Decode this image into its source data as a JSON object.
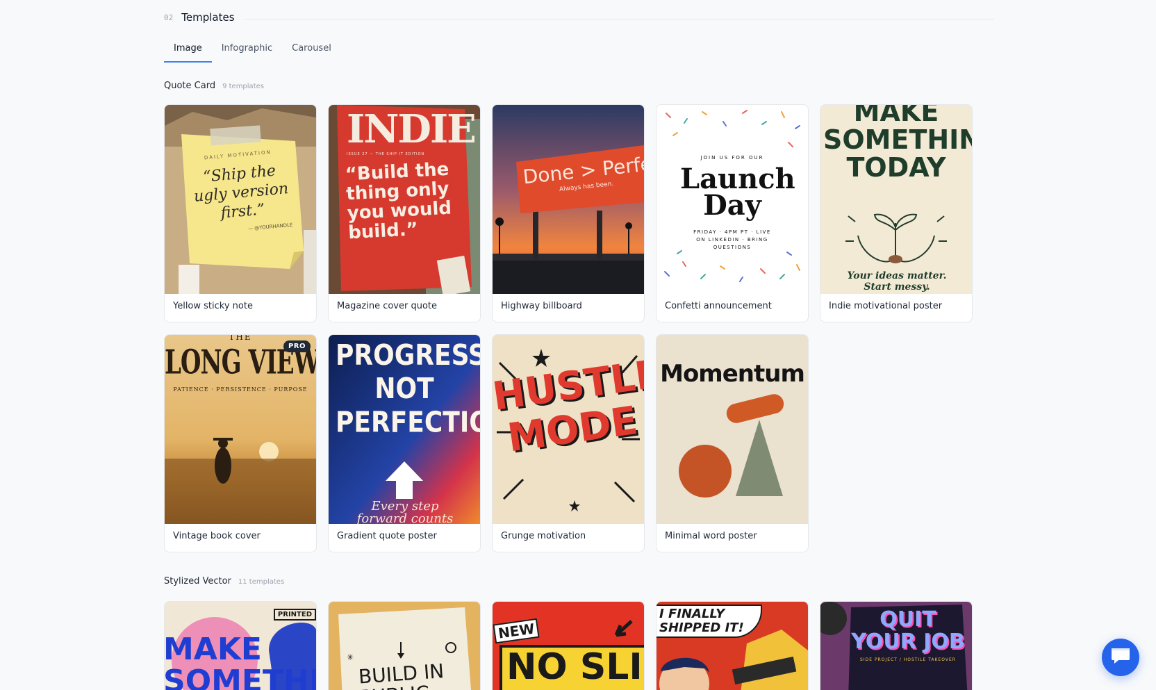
{
  "section": {
    "number": "02",
    "title": "Templates"
  },
  "tabs": [
    {
      "label": "Image",
      "active": true
    },
    {
      "label": "Infographic",
      "active": false
    },
    {
      "label": "Carousel",
      "active": false
    }
  ],
  "groups": [
    {
      "title": "Quote Card",
      "count": "9 templates",
      "templates": [
        {
          "label": "Yellow sticky note",
          "art": {
            "eyebrow": "DAILY MOTIVATION",
            "quote": "“Ship the ugly version first.”",
            "byline": "— @YOURHANDLE"
          }
        },
        {
          "label": "Magazine cover quote",
          "art": {
            "masthead": "INDIE",
            "issue": "ISSUE 27 — THE SHIP IT EDITION",
            "quote": "“Build the thing only you would build.”"
          }
        },
        {
          "label": "Highway billboard",
          "art": {
            "headline": "Done > Perfe",
            "tagline": "Always has been."
          }
        },
        {
          "label": "Confetti announcement",
          "art": {
            "eyebrow": "JOIN US FOR OUR",
            "headline": "Launch Day",
            "details": "FRIDAY · 4PM PT · LIVE ON LINKEDIN · BRING QUESTIONS"
          }
        },
        {
          "label": "Indie motivational poster",
          "art": {
            "headline": "MAKE SOMETHING TODAY",
            "footer": "Your ideas matter. Start messy."
          }
        },
        {
          "label": "Vintage book cover",
          "pro": "PRO",
          "art": {
            "kicker": "THE",
            "headline": "LONG VIEW",
            "subtitle": "PATIENCE · PERSISTENCE · PURPOSE"
          }
        },
        {
          "label": "Gradient quote poster",
          "art": {
            "headline": "PROGRESS NOT PERFECTION",
            "footer": "Every step forward counts"
          }
        },
        {
          "label": "Grunge motivation",
          "art": {
            "headline": "HUSTLE MODE"
          }
        },
        {
          "label": "Minimal word poster",
          "art": {
            "headline": "Momentum"
          }
        }
      ]
    },
    {
      "title": "Stylized Vector",
      "count": "11 templates",
      "templates": [
        {
          "art": {
            "headline": "MAKE SOMETHING",
            "stamp": "PRINTED"
          }
        },
        {
          "art": {
            "headline": "BUILD IN PUBLIC"
          }
        },
        {
          "art": {
            "sticker": "NEW",
            "headline": "NO SLIDES"
          }
        },
        {
          "art": {
            "bubble": "I FINALLY SHIPPED IT!"
          }
        },
        {
          "art": {
            "headline": "QUIT YOUR JOB",
            "subtitle": "SIDE PROJECT / HOSTILE TAKEOVER"
          }
        }
      ]
    }
  ],
  "colors": {
    "accent": "#3b82f6",
    "chat_button": "#2563eb"
  },
  "chat": {
    "icon": "chat-bubble-icon"
  }
}
